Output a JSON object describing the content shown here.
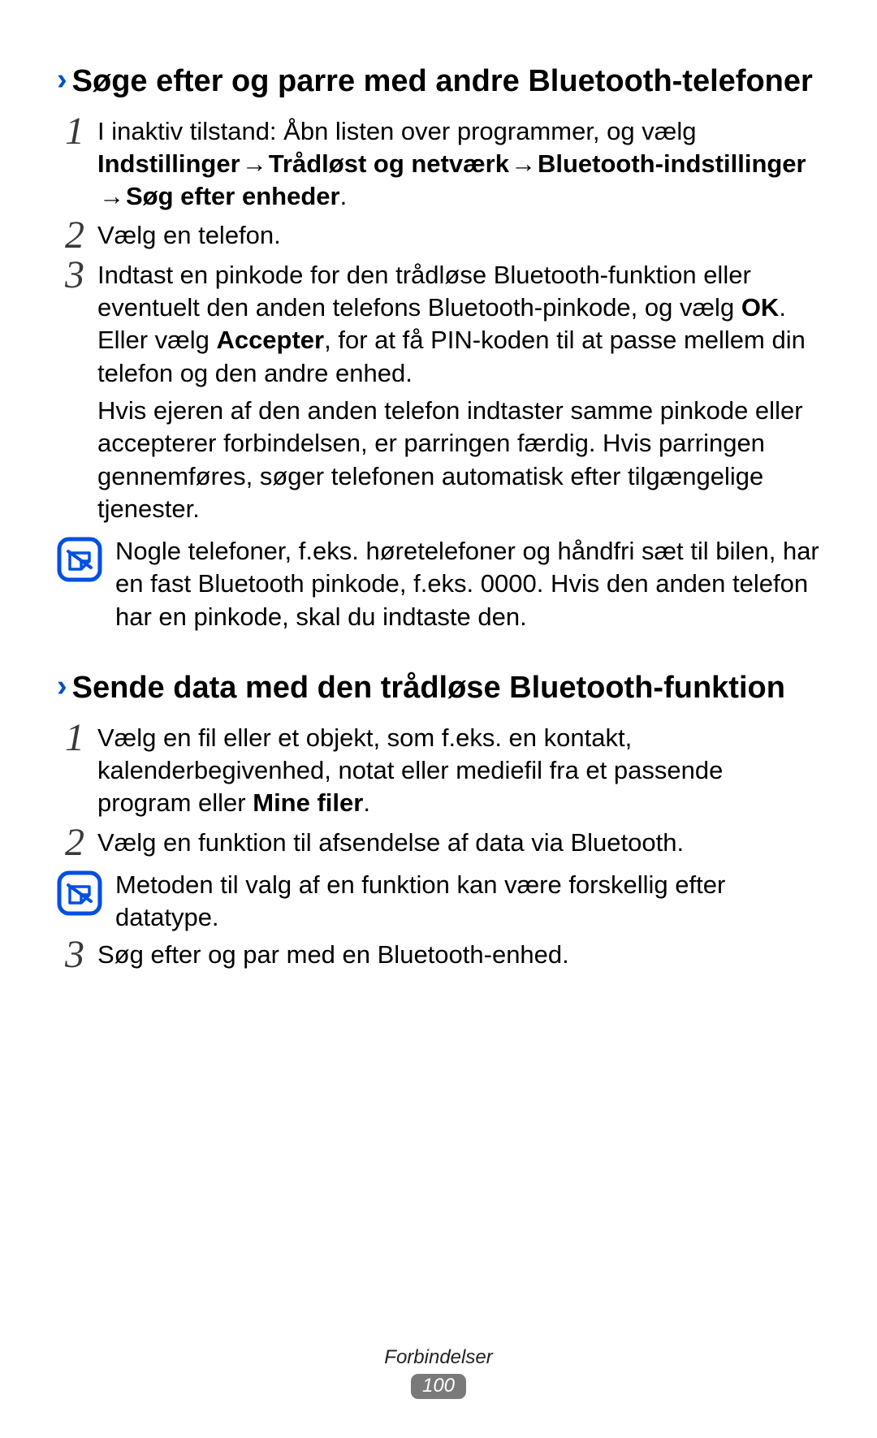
{
  "section1": {
    "chevron": "›",
    "title": "Søge efter og parre med andre Bluetooth-telefoner",
    "step1": {
      "num": "1",
      "t1": "I inaktiv tilstand: Åbn listen over programmer, og vælg ",
      "b1": "Indstillinger",
      "arr": " → ",
      "b2": "Trådløst og netværk",
      "b3": "Bluetooth-indstillinger",
      "b4": "Søg efter enheder",
      "dot": "."
    },
    "step2": {
      "num": "2",
      "t": "Vælg en telefon."
    },
    "step3": {
      "num": "3",
      "t1": "Indtast en pinkode for den trådløse Bluetooth-funktion eller eventuelt den anden telefons Bluetooth-pinkode, og vælg ",
      "b1": "OK",
      "t2": ". Eller vælg ",
      "b2": "Accepter",
      "t3": ", for at få PIN-koden til at passe mellem din telefon og den andre enhed.",
      "p2": "Hvis ejeren af den anden telefon indtaster samme pinkode eller accepterer forbindelsen, er parringen færdig. Hvis parringen gennemføres, søger telefonen automatisk efter tilgængelige tjenester."
    },
    "note": "Nogle telefoner, f.eks. høretelefoner og håndfri sæt til bilen, har en fast Bluetooth pinkode, f.eks. 0000. Hvis den anden telefon har en pinkode, skal du indtaste den."
  },
  "section2": {
    "chevron": "›",
    "title": "Sende data med den trådløse Bluetooth-funktion",
    "step1": {
      "num": "1",
      "t1": "Vælg en fil eller et objekt, som f.eks. en kontakt, kalenderbegivenhed, notat eller mediefil fra et passende program eller ",
      "b1": "Mine filer",
      "dot": "."
    },
    "step2": {
      "num": "2",
      "t": "Vælg en funktion til afsendelse af data via Bluetooth."
    },
    "note": "Metoden til valg af en funktion kan være forskellig efter datatype.",
    "step3": {
      "num": "3",
      "t": "Søg efter og par med en Bluetooth-enhed."
    }
  },
  "footer": {
    "title": "Forbindelser",
    "page": "100"
  }
}
